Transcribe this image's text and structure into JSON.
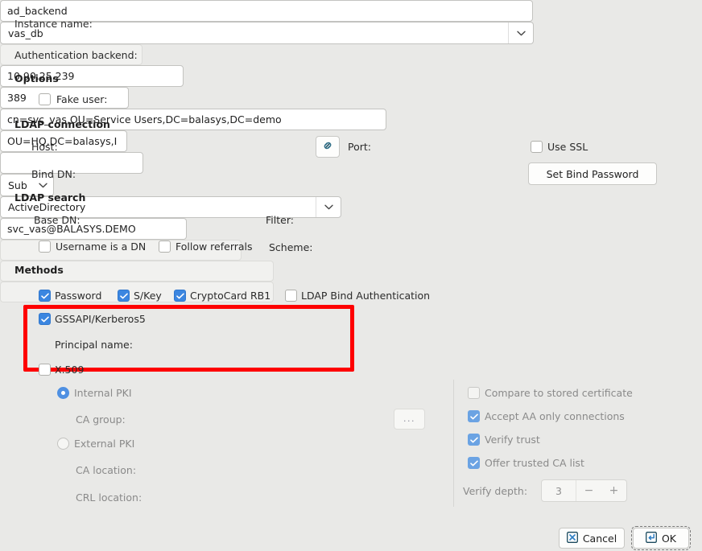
{
  "top": {
    "instance_name_label": "Instance name:",
    "instance_name_value": "ad_backend",
    "auth_backend_label": "Authentication backend:",
    "auth_backend_value": "vas_db"
  },
  "options": {
    "title": "Options",
    "fake_user_label": "Fake user:",
    "fake_user_checked": false,
    "fake_user_value": ""
  },
  "ldap_connection": {
    "title": "LDAP connection",
    "host_label": "Host:",
    "host_value": "10.90.25.239",
    "link_icon": "chain-link-icon",
    "port_label": "Port:",
    "port_value": "389",
    "use_ssl_label": "Use SSL",
    "use_ssl_checked": false,
    "bind_dn_label": "Bind DN:",
    "bind_dn_value": "cn=svc_vas,OU=Service Users,DC=balasys,DC=demo",
    "set_bind_password_label": "Set Bind Password"
  },
  "ldap_search": {
    "title": "LDAP search",
    "base_dn_label": "Base DN:",
    "base_dn_value": "OU=HQ,DC=balasys,I",
    "filter_label": "Filter:",
    "filter_value": "",
    "scope_value": "Sub",
    "username_is_dn_label": "Username is a DN",
    "username_is_dn_checked": false,
    "follow_referrals_label": "Follow referrals",
    "follow_referrals_checked": false,
    "scheme_label": "Scheme:",
    "scheme_value": "ActiveDirectory"
  },
  "methods": {
    "title": "Methods",
    "password_label": "Password",
    "password_checked": true,
    "skey_label": "S/Key",
    "skey_checked": true,
    "cryptocard_label": "CryptoCard RB1",
    "cryptocard_checked": true,
    "ldap_bind_label": "LDAP Bind Authentication",
    "ldap_bind_checked": false,
    "gssapi_label": "GSSAPI/Kerberos5",
    "gssapi_checked": true,
    "principal_name_label": "Principal name:",
    "principal_name_value": "svc_vas@BALASYS.DEMO",
    "highlight_color": "#fe0000"
  },
  "x509": {
    "title": "X.509",
    "checked": false,
    "internal_pki_label": "Internal PKI",
    "internal_pki_selected": true,
    "ca_group_label": "CA group:",
    "ca_group_value": "",
    "ca_group_browse_label": "...",
    "external_pki_label": "External PKI",
    "external_pki_selected": false,
    "ca_location_label": "CA location:",
    "ca_location_value": "",
    "crl_location_label": "CRL location:",
    "crl_location_value": ""
  },
  "x509_right": {
    "compare_stored_cert_label": "Compare to stored certificate",
    "compare_stored_cert_checked": false,
    "accept_aa_only_label": "Accept AA only connections",
    "accept_aa_only_checked": true,
    "verify_trust_label": "Verify trust",
    "verify_trust_checked": true,
    "offer_trusted_ca_label": "Offer trusted CA list",
    "offer_trusted_ca_checked": true,
    "verify_depth_label": "Verify depth:",
    "verify_depth_value": "3",
    "decrement_label": "−",
    "increment_label": "+"
  },
  "footer": {
    "cancel_label": "Cancel",
    "cancel_icon": "close-x-icon",
    "ok_label": "OK",
    "ok_icon": "enter-return-icon"
  }
}
